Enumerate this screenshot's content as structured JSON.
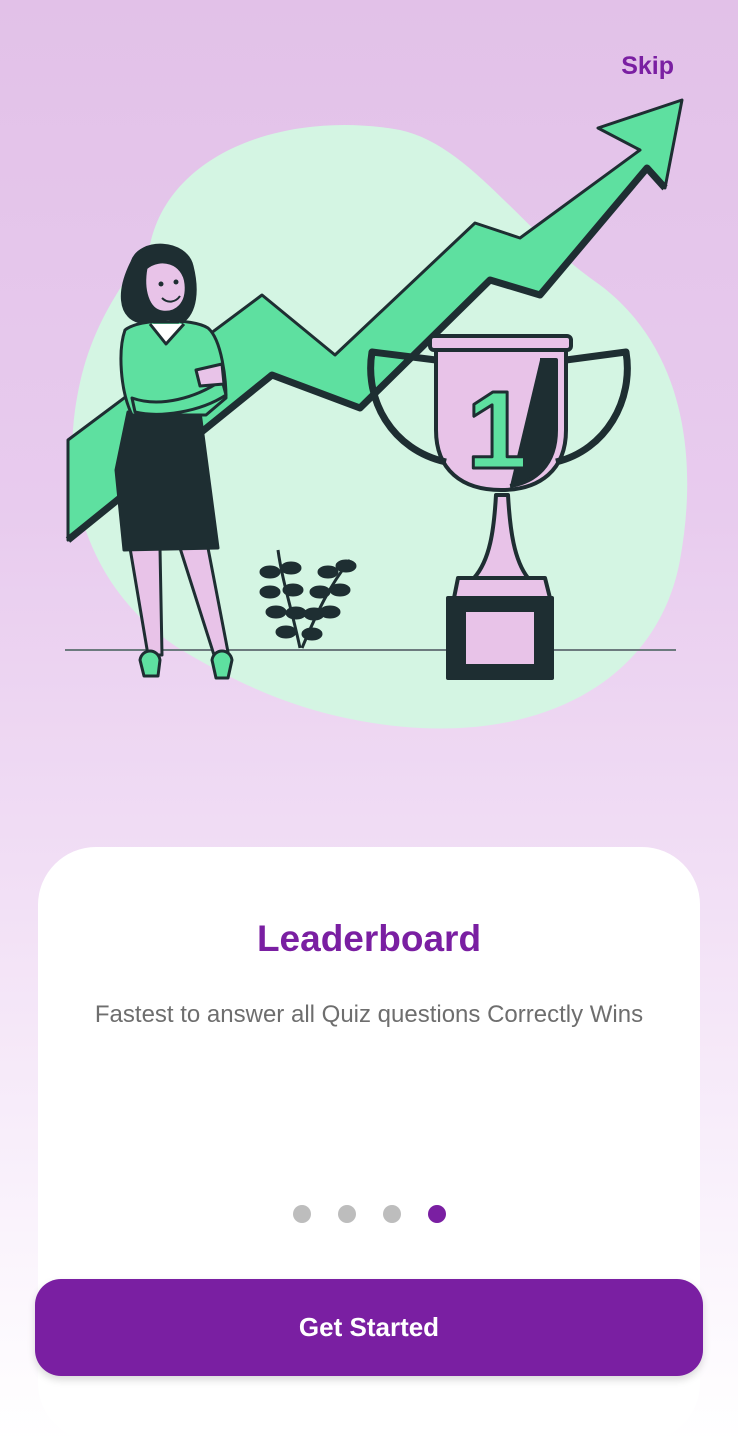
{
  "header": {
    "skip_label": "Skip"
  },
  "illustration": {
    "name": "leaderboard-illustration",
    "trophy_number": "1"
  },
  "card": {
    "title": "Leaderboard",
    "description": "Fastest to answer all Quiz questions Correctly Wins"
  },
  "pager": {
    "count": 4,
    "active_index": 3
  },
  "cta": {
    "label": "Get Started"
  },
  "colors": {
    "accent": "#7a1fa2",
    "illustration_green": "#5ee0a0",
    "illustration_blob": "#d4f5e3",
    "illustration_dark": "#1e2e32",
    "trophy_pink": "#e8c3e8",
    "dot_inactive": "#bdbdbd"
  }
}
